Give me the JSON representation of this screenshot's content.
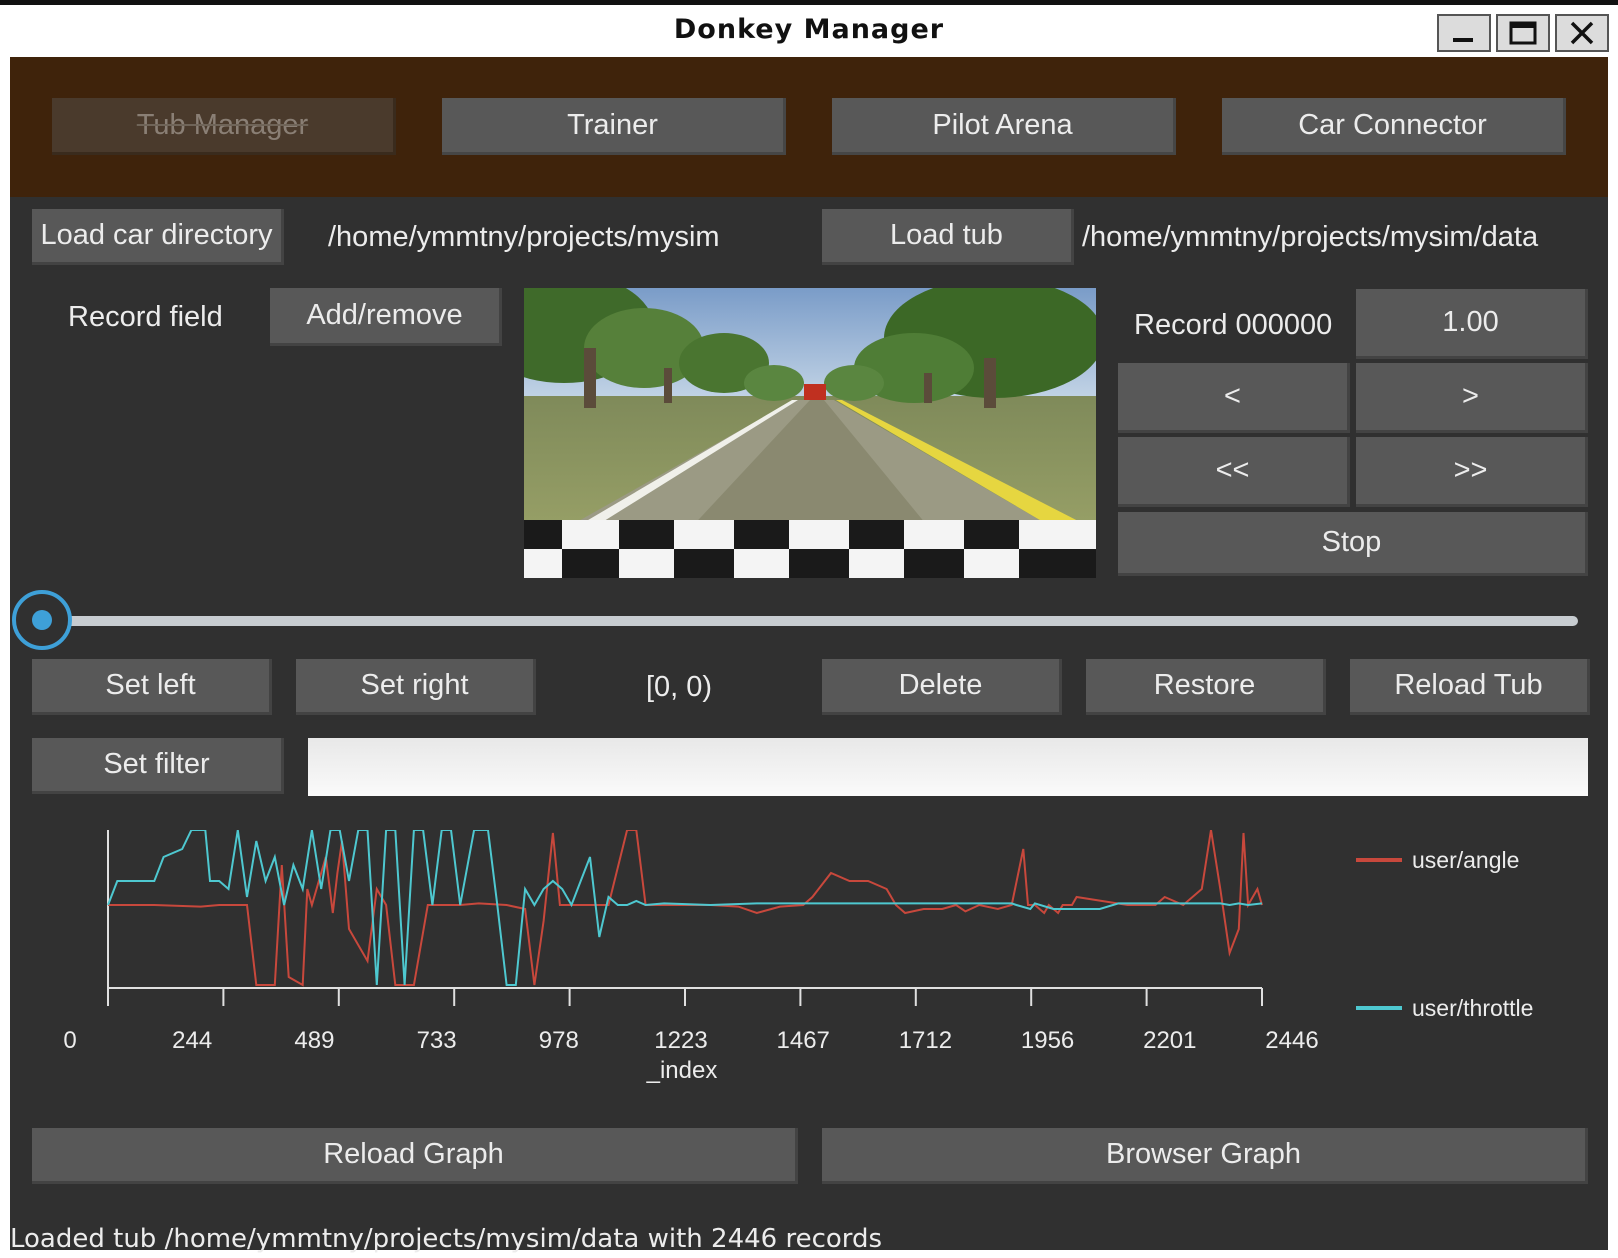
{
  "window": {
    "title": "Donkey Manager",
    "controls": [
      "minimize",
      "maximize",
      "close"
    ]
  },
  "nav": {
    "tabs": [
      {
        "label": "Tub Manager",
        "disabled": true
      },
      {
        "label": "Trainer",
        "disabled": false
      },
      {
        "label": "Pilot Arena",
        "disabled": false
      },
      {
        "label": "Car Connector",
        "disabled": false
      }
    ]
  },
  "paths": {
    "load_car_label": "Load car directory",
    "car_dir": "/home/ymmtny/projects/mysim",
    "load_tub_label": "Load tub",
    "tub_dir": "/home/ymmtny/projects/mysim/data"
  },
  "fields": {
    "record_field_label": "Record field",
    "add_remove_label": "Add/remove"
  },
  "player": {
    "record_label": "Record 000000",
    "speed": "1.00",
    "prev": "<",
    "next": ">",
    "rewind": "<<",
    "fast_forward": ">>",
    "stop": "Stop",
    "slider_value": 0
  },
  "edit": {
    "set_left": "Set left",
    "set_right": "Set right",
    "range": "[0, 0)",
    "delete": "Delete",
    "restore": "Restore",
    "reload_tub": "Reload Tub",
    "set_filter": "Set filter",
    "filter_value": ""
  },
  "chart_data": {
    "type": "line",
    "xlabel": "_index",
    "ylabel": "",
    "xlim": [
      0,
      2446
    ],
    "ylim": [
      -1,
      1
    ],
    "x_ticks": [
      "0",
      "244",
      "489",
      "733",
      "978",
      "1223",
      "1467",
      "1712",
      "1956",
      "2201",
      "2446"
    ],
    "legend_position": "right",
    "series": [
      {
        "name": "user/angle",
        "color": "#c8483c",
        "points": [
          [
            0,
            0
          ],
          [
            100,
            0
          ],
          [
            200,
            -0.02
          ],
          [
            240,
            0
          ],
          [
            300,
            0
          ],
          [
            320,
            -1
          ],
          [
            360,
            -1
          ],
          [
            375,
            0.5
          ],
          [
            390,
            -0.9
          ],
          [
            420,
            -1
          ],
          [
            430,
            0.2
          ],
          [
            440,
            0
          ],
          [
            470,
            0.6
          ],
          [
            485,
            -0.1
          ],
          [
            495,
            0.4
          ],
          [
            505,
            0.8
          ],
          [
            520,
            -0.3
          ],
          [
            560,
            -0.7
          ],
          [
            580,
            0.2
          ],
          [
            600,
            0
          ],
          [
            620,
            -1
          ],
          [
            660,
            -1
          ],
          [
            690,
            0
          ],
          [
            760,
            0
          ],
          [
            800,
            0.02
          ],
          [
            860,
            0
          ],
          [
            900,
            -0.05
          ],
          [
            920,
            -1
          ],
          [
            940,
            -0.2
          ],
          [
            960,
            0.9
          ],
          [
            975,
            0
          ],
          [
            1000,
            0
          ],
          [
            1080,
            0
          ],
          [
            1120,
            0.95
          ],
          [
            1140,
            0.95
          ],
          [
            1160,
            0
          ],
          [
            1300,
            0
          ],
          [
            1360,
            -0.02
          ],
          [
            1400,
            -0.1
          ],
          [
            1450,
            -0.02
          ],
          [
            1500,
            0
          ],
          [
            1520,
            0.1
          ],
          [
            1560,
            0.4
          ],
          [
            1600,
            0.3
          ],
          [
            1640,
            0.3
          ],
          [
            1680,
            0.2
          ],
          [
            1700,
            0
          ],
          [
            1720,
            -0.1
          ],
          [
            1760,
            -0.05
          ],
          [
            1800,
            -0.05
          ],
          [
            1830,
            0
          ],
          [
            1850,
            -0.08
          ],
          [
            1880,
            0
          ],
          [
            1920,
            -0.05
          ],
          [
            1950,
            0
          ],
          [
            1975,
            0.7
          ],
          [
            1985,
            0
          ],
          [
            2000,
            0
          ],
          [
            2020,
            -0.1
          ],
          [
            2030,
            0
          ],
          [
            2050,
            -0.1
          ],
          [
            2060,
            0
          ],
          [
            2080,
            0
          ],
          [
            2090,
            0.1
          ],
          [
            2200,
            0
          ],
          [
            2260,
            0
          ],
          [
            2280,
            0.1
          ],
          [
            2320,
            0
          ],
          [
            2360,
            0.2
          ],
          [
            2380,
            0.95
          ],
          [
            2400,
            0.2
          ],
          [
            2420,
            -0.6
          ],
          [
            2440,
            -0.3
          ],
          [
            2450,
            0.9
          ],
          [
            2460,
            0
          ],
          [
            2480,
            0.2
          ],
          [
            2490,
            0
          ]
        ]
      },
      {
        "name": "user/throttle",
        "color": "#4ec8d0",
        "points": [
          [
            0,
            0
          ],
          [
            20,
            0.3
          ],
          [
            40,
            0.3
          ],
          [
            100,
            0.3
          ],
          [
            120,
            0.6
          ],
          [
            160,
            0.7
          ],
          [
            180,
            0.95
          ],
          [
            210,
            0.95
          ],
          [
            220,
            0.3
          ],
          [
            240,
            0.3
          ],
          [
            260,
            0.2
          ],
          [
            280,
            0.95
          ],
          [
            300,
            0.1
          ],
          [
            320,
            0.8
          ],
          [
            340,
            0.3
          ],
          [
            360,
            0.6
          ],
          [
            380,
            0
          ],
          [
            400,
            0.5
          ],
          [
            420,
            0.2
          ],
          [
            440,
            0.95
          ],
          [
            460,
            0.2
          ],
          [
            480,
            0.95
          ],
          [
            500,
            0.95
          ],
          [
            520,
            0.3
          ],
          [
            540,
            0.95
          ],
          [
            560,
            0.95
          ],
          [
            580,
            -1
          ],
          [
            600,
            0.95
          ],
          [
            620,
            0.95
          ],
          [
            640,
            -1
          ],
          [
            660,
            0.95
          ],
          [
            680,
            0.95
          ],
          [
            700,
            0
          ],
          [
            720,
            0.95
          ],
          [
            740,
            0.95
          ],
          [
            760,
            0
          ],
          [
            790,
            0.95
          ],
          [
            820,
            0.95
          ],
          [
            840,
            0
          ],
          [
            860,
            -1
          ],
          [
            880,
            -1
          ],
          [
            900,
            0.2
          ],
          [
            920,
            0
          ],
          [
            940,
            0.2
          ],
          [
            960,
            0.3
          ],
          [
            980,
            0.2
          ],
          [
            1000,
            0
          ],
          [
            1020,
            0.3
          ],
          [
            1040,
            0.6
          ],
          [
            1060,
            -0.4
          ],
          [
            1080,
            0.1
          ],
          [
            1100,
            0
          ],
          [
            1120,
            0
          ],
          [
            1140,
            0.05
          ],
          [
            1160,
            0
          ],
          [
            1200,
            0.02
          ],
          [
            1300,
            0
          ],
          [
            1400,
            0.02
          ],
          [
            1500,
            0.02
          ],
          [
            1600,
            0.02
          ],
          [
            1700,
            0.02
          ],
          [
            1800,
            0.02
          ],
          [
            1900,
            0.02
          ],
          [
            1950,
            0.02
          ],
          [
            1960,
            0
          ],
          [
            1990,
            -0.05
          ],
          [
            2000,
            0.02
          ],
          [
            2040,
            -0.05
          ],
          [
            2100,
            -0.05
          ],
          [
            2140,
            -0.05
          ],
          [
            2180,
            0.02
          ],
          [
            2260,
            0.02
          ],
          [
            2300,
            0.02
          ],
          [
            2350,
            0.02
          ],
          [
            2400,
            0.02
          ],
          [
            2420,
            0
          ],
          [
            2440,
            0.02
          ],
          [
            2460,
            0
          ],
          [
            2490,
            0.02
          ]
        ]
      }
    ]
  },
  "graph_buttons": {
    "reload_graph": "Reload Graph",
    "browser_graph": "Browser Graph"
  },
  "status": "Loaded tub /home/ymmtny/projects/mysim/data with 2446 records"
}
